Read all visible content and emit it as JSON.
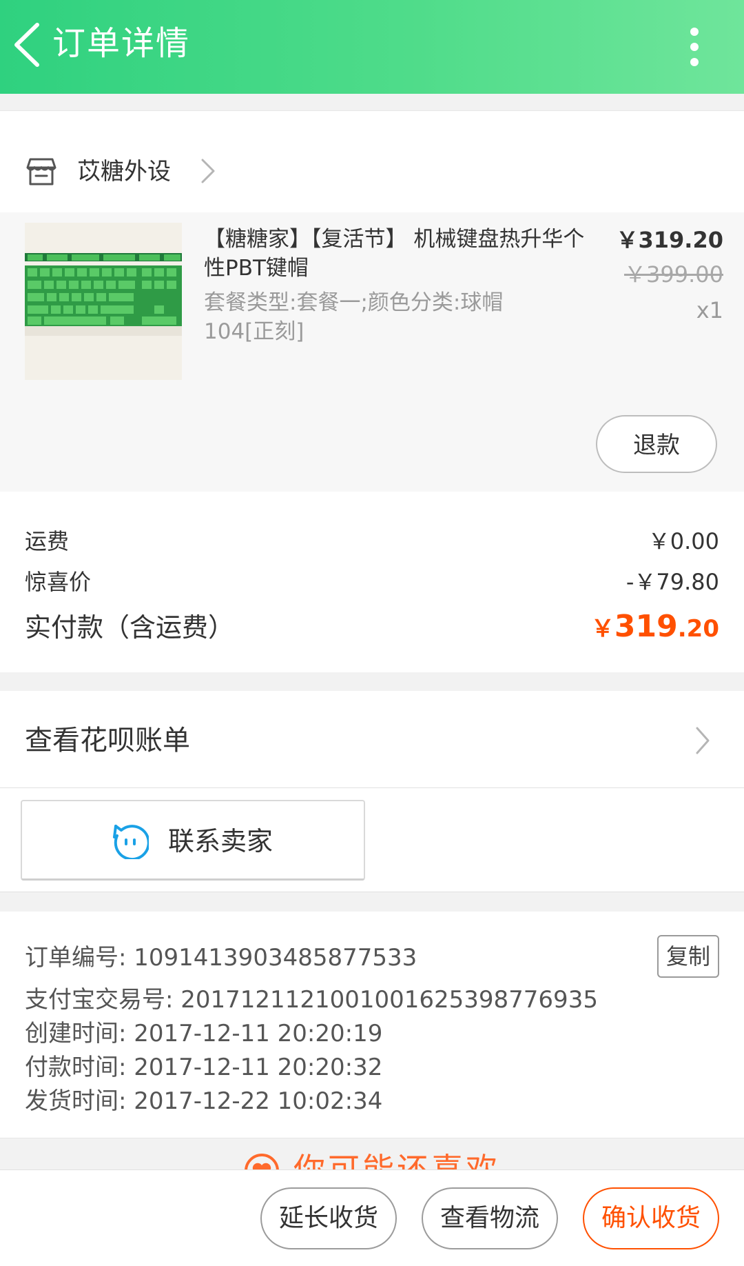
{
  "header": {
    "title": "订单详情"
  },
  "shop": {
    "name": "苡糖外设"
  },
  "item": {
    "title": "【糖糖家】【复活节】 机械键盘热升华个性PBT键帽",
    "spec": "套餐类型:套餐一;颜色分类:球帽104[正刻]",
    "price": "￥319.20",
    "original_price": "￥399.00",
    "quantity": "x1",
    "refund_label": "退款"
  },
  "fees": {
    "shipping_label": "运费",
    "shipping_value": "￥0.00",
    "discount_label": "惊喜价",
    "discount_value": "-￥79.80",
    "total_label": "实付款（含运费）",
    "total_currency": "￥",
    "total_int": "319",
    "total_dec": ".20"
  },
  "huabei": {
    "label": "查看花呗账单"
  },
  "contact": {
    "label": "联系卖家"
  },
  "order_info": {
    "order_no": "订单编号: 1091413903485877533",
    "alipay_no": "支付宝交易号: 2017121121001001625398776935",
    "created": "创建时间: 2017-12-11 20:20:19",
    "paid": "付款时间: 2017-12-11 20:20:32",
    "shipped": "发货时间: 2017-12-22 10:02:34",
    "copy_label": "复制"
  },
  "recommend": {
    "label": "你可能还喜欢"
  },
  "actions": {
    "extend": "延长收货",
    "logistics": "查看物流",
    "confirm": "确认收货"
  },
  "colors": {
    "header_green": "#3fd785",
    "accent_orange": "#ff5000"
  }
}
